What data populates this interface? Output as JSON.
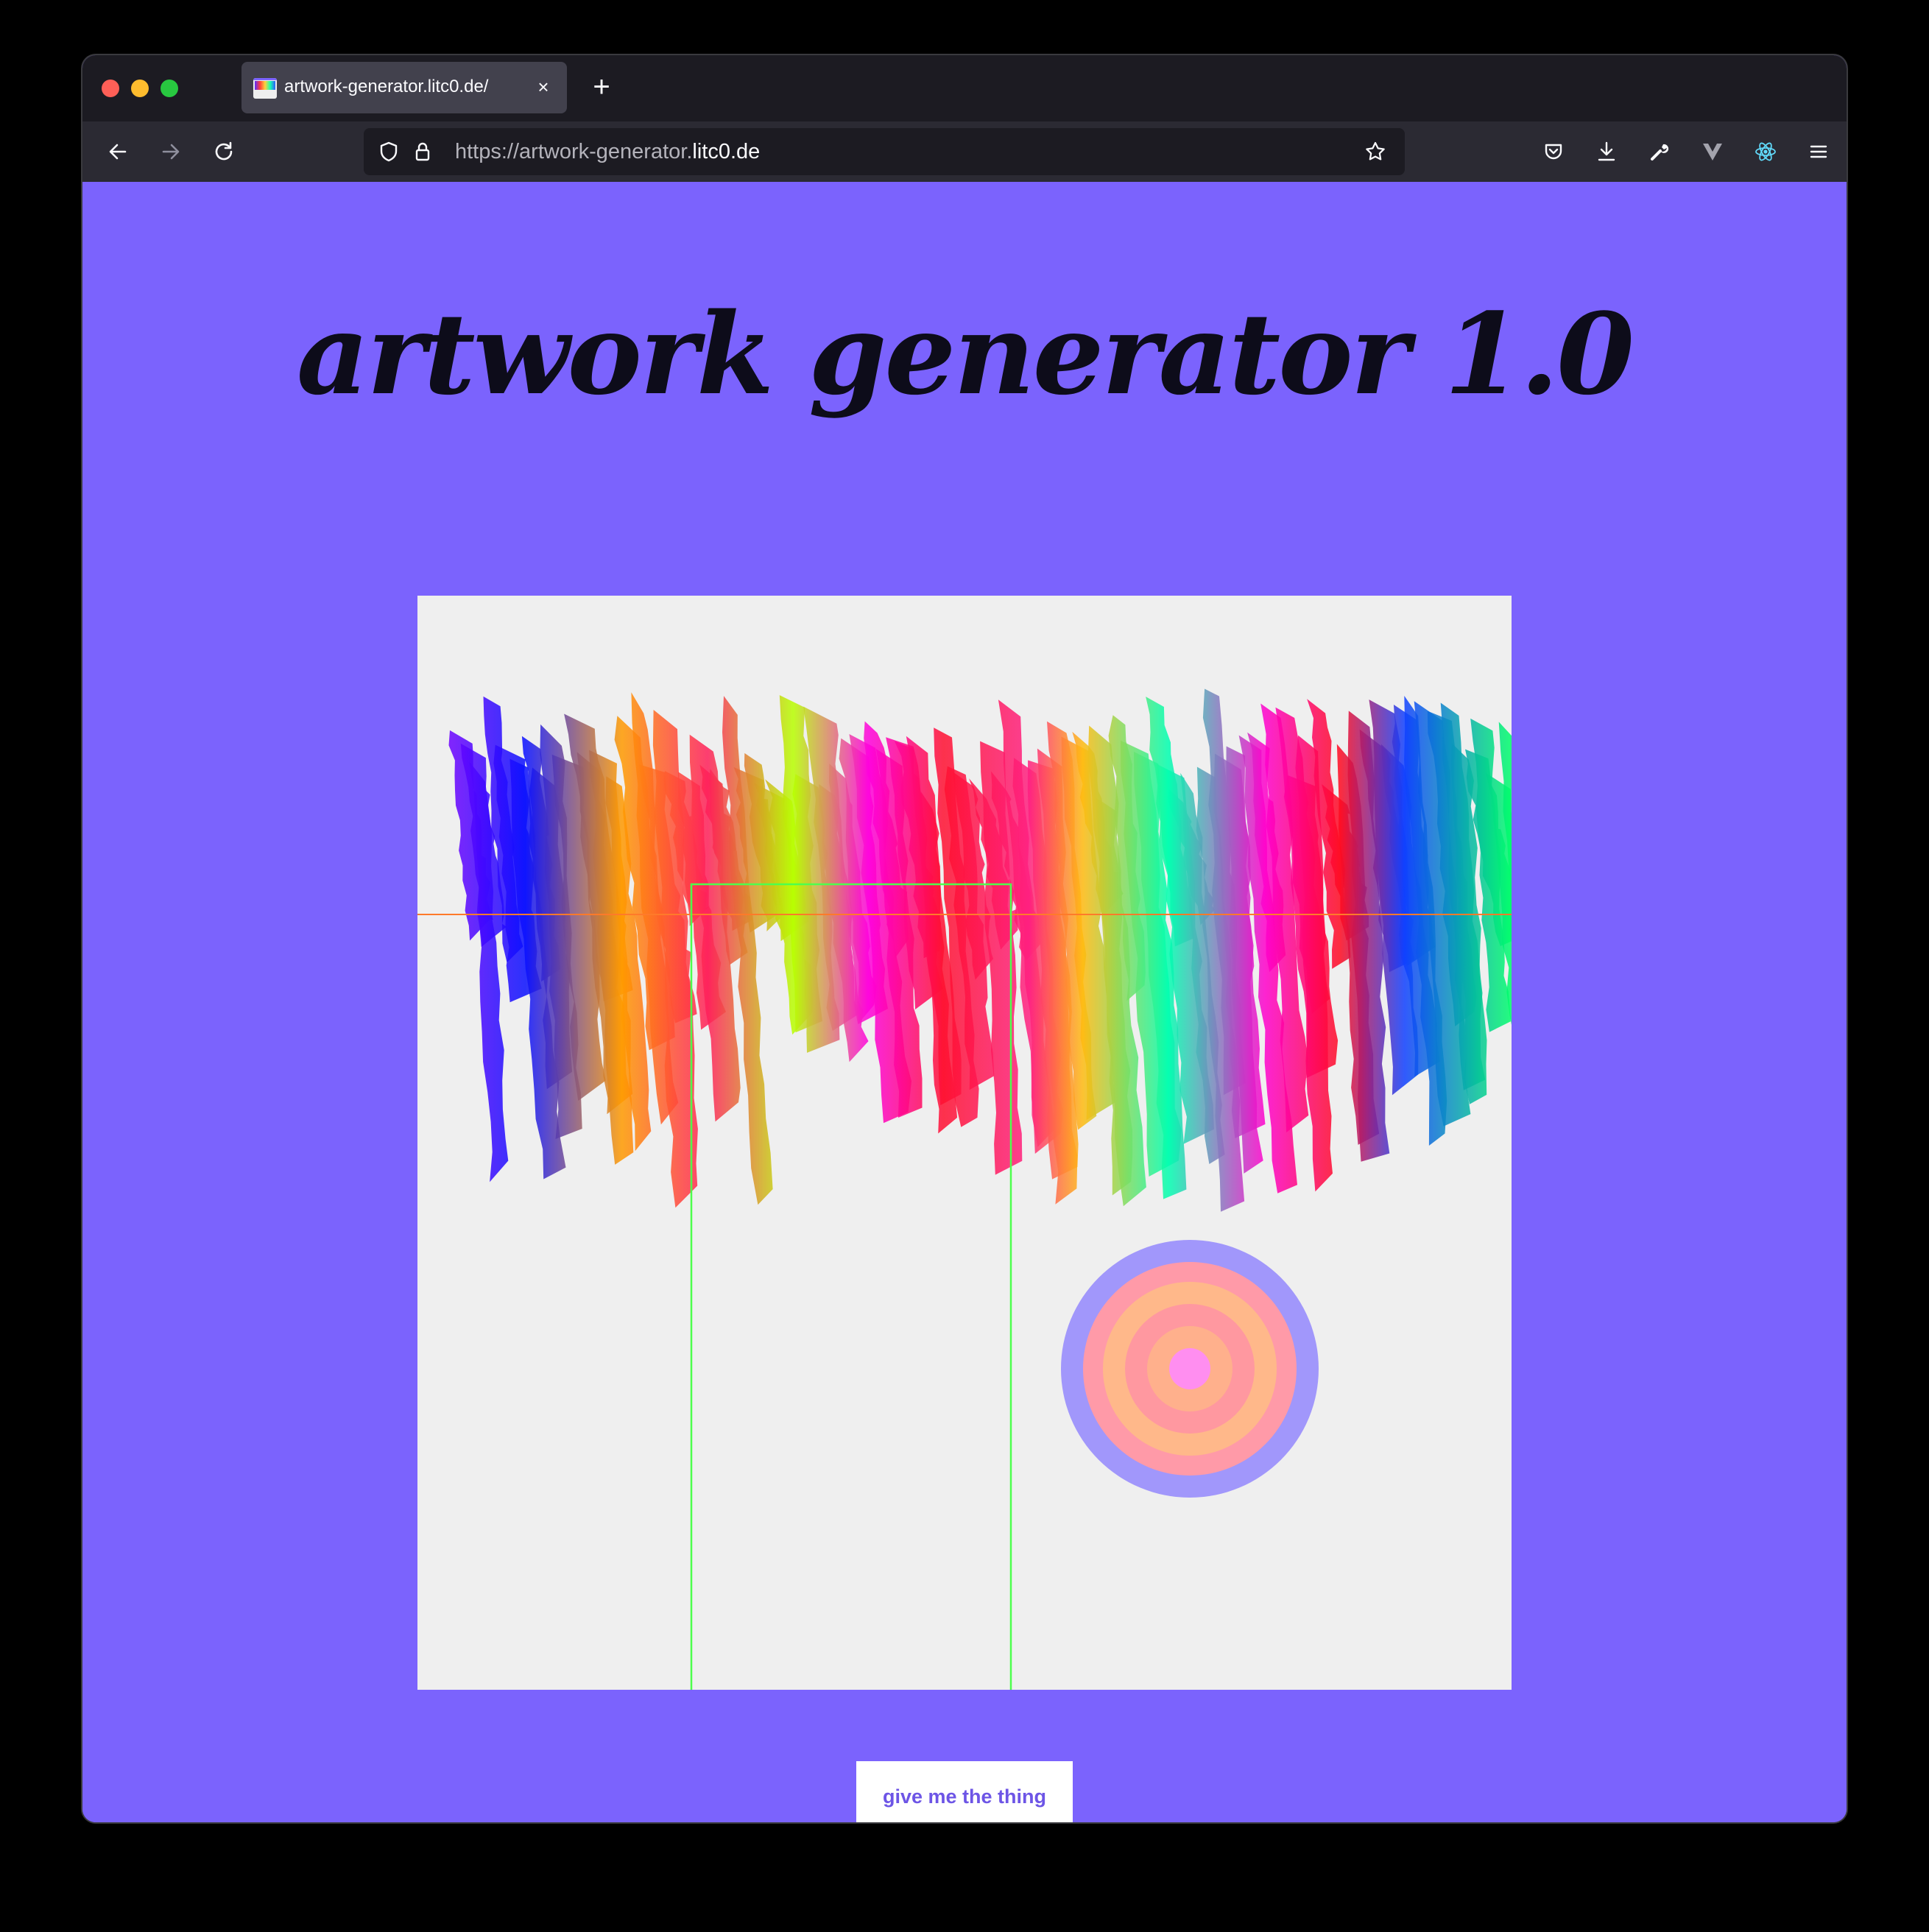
{
  "browser": {
    "tab_title": "artwork-generator.litc0.de/",
    "tab_close": "×",
    "new_tab": "+",
    "url_prefix": "https://artwork-generator.",
    "url_domain": "litc0.de"
  },
  "page": {
    "headline": "artwork generator 1.0",
    "button_label": "give me the thing",
    "background_color": "#7b63fd",
    "canvas_color": "#efefef"
  },
  "icons": [
    "back-arrow-icon",
    "forward-arrow-icon",
    "reload-icon",
    "shield-icon",
    "lock-icon",
    "bookmark-star-icon",
    "pocket-icon",
    "download-icon",
    "wrench-icon",
    "vue-devtools-icon",
    "react-devtools-icon",
    "hamburger-menu-icon"
  ]
}
